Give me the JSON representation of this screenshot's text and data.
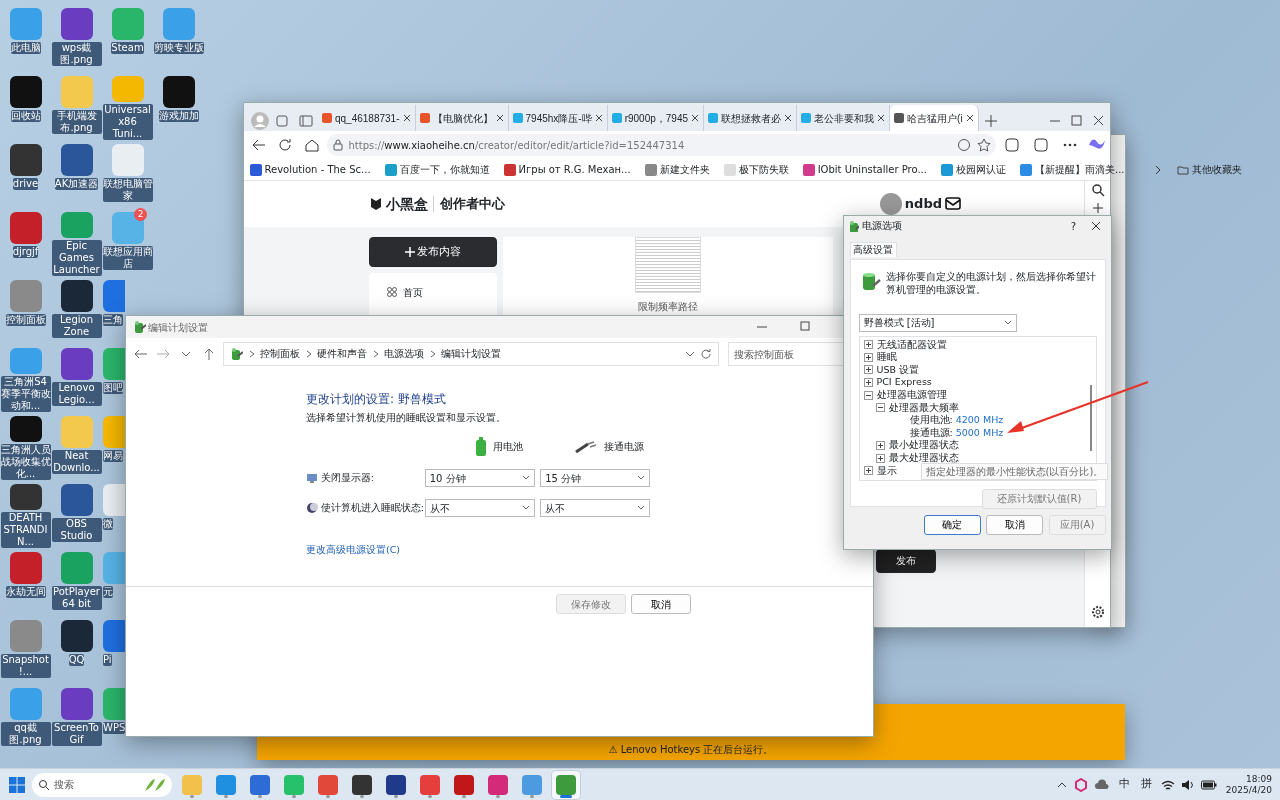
{
  "desktop": {
    "columns": [
      {
        "items": [
          {
            "label": "此电脑"
          },
          {
            "label": "回收站"
          },
          {
            "label": "drive"
          },
          {
            "label": "djrgjf"
          },
          {
            "label": "控制面板"
          },
          {
            "label": "三角洲S4赛季平衡改动和..."
          },
          {
            "label": "三角洲人员战场收集优化..."
          },
          {
            "label": "DEATH STRANDIN..."
          },
          {
            "label": "永劫无间"
          },
          {
            "label": "Snapshot!..."
          },
          {
            "label": "qq截图.png"
          }
        ]
      },
      {
        "items": [
          {
            "label": "wps截图.png"
          },
          {
            "label": "手机端发布.png"
          },
          {
            "label": "AK加速器"
          },
          {
            "label": "Epic Games Launcher"
          },
          {
            "label": "Legion Zone"
          },
          {
            "label": "Lenovo Legio..."
          },
          {
            "label": "Neat Downlo..."
          },
          {
            "label": "OBS Studio"
          },
          {
            "label": "PotPlayer 64 bit"
          },
          {
            "label": "QQ"
          },
          {
            "label": "ScreenToGif"
          }
        ]
      },
      {
        "items": [
          {
            "label": "Steam"
          },
          {
            "label": "Universal x86 Tuni..."
          },
          {
            "label": "联想电脑管家"
          },
          {
            "label": "联想应用商店",
            "badge": "2"
          },
          {
            "label": "三角"
          },
          {
            "label": "图吧"
          },
          {
            "label": "网易"
          },
          {
            "label": "微"
          },
          {
            "label": "元"
          },
          {
            "label": "Pi"
          },
          {
            "label": "WPS"
          }
        ]
      },
      {
        "items": [
          {
            "label": "剪映专业版"
          },
          {
            "label": "游戏加加"
          }
        ]
      }
    ]
  },
  "browser": {
    "tabs": [
      {
        "title": "qq_46188731-",
        "selected": false
      },
      {
        "title": "【电脑优化】",
        "selected": false
      },
      {
        "title": "7945hx降压-哔",
        "selected": false
      },
      {
        "title": "r9000p，7945",
        "selected": false
      },
      {
        "title": "联想拯救者必",
        "selected": false
      },
      {
        "title": "老公非要和我",
        "selected": false
      },
      {
        "title": "哈吉猛用户(i",
        "selected": true
      }
    ],
    "address": {
      "prefix": "https://",
      "host": "www.xiaoheihe.cn",
      "path": "/creator/editor/edit/article?id=152447314"
    },
    "bookmarks": [
      "Revolution - The Sc...",
      "百度一下，你就知道",
      "Игры от R.G. Механ...",
      "新建文件夹",
      "极下防失联",
      "IObit Uninstaller Pro...",
      "校园网认证",
      "【新提醒】雨滴美..."
    ],
    "other_bookmarks": "其他收藏夹",
    "page": {
      "logo": "小黑盒",
      "section": "创作者中心",
      "username": "ndbd",
      "publish_content": "发布内容",
      "nav": [
        {
          "label": "首页"
        }
      ],
      "image_caption": "限制频率路径",
      "publish": "发布"
    }
  },
  "notification": {
    "text": "⚠ Lenovo Hotkeys 正在后台运行。"
  },
  "edit_plan": {
    "title": "编辑计划设置",
    "breadcrumb": [
      "控制面板",
      "硬件和声音",
      "电源选项",
      "编辑计划设置"
    ],
    "search": {
      "placeholder": "搜索控制面板"
    },
    "heading": "更改计划的设置: 野兽模式",
    "description": "选择希望计算机使用的睡眠设置和显示设置。",
    "columns": [
      "用电池",
      "接通电源"
    ],
    "settings": [
      {
        "kind": "display",
        "label": "关闭显示器:",
        "values": [
          "10 分钟",
          "15 分钟"
        ]
      },
      {
        "kind": "sleep",
        "label": "使计算机进入睡眠状态:",
        "values": [
          "从不",
          "从不"
        ]
      }
    ],
    "advanced_link": "更改高级电源设置(C)",
    "buttons": [
      {
        "label": "保存修改",
        "disabled": true
      },
      {
        "label": "取消",
        "disabled": false
      }
    ]
  },
  "power_options": {
    "title": "电源选项",
    "help": "?",
    "tab": "高级设置",
    "intro": "选择你要自定义的电源计划，然后选择你希望计算机管理的电源设置。",
    "plan": "野兽模式 [活动]",
    "tree": [
      {
        "label": "无线适配器设置",
        "expanded": false
      },
      {
        "label": "睡眠",
        "expanded": false
      },
      {
        "label": "USB 设置",
        "expanded": false
      },
      {
        "label": "PCI Express",
        "expanded": false
      },
      {
        "label": "处理器电源管理",
        "expanded": true,
        "children": [
          {
            "label": "处理器最大频率",
            "expanded": true,
            "children": [
              {
                "label": "使用电池:",
                "value": "4200 MHz"
              },
              {
                "label": "接通电源:",
                "value": "5000 MHz"
              }
            ]
          },
          {
            "label": "最小处理器状态",
            "expanded": false
          },
          {
            "label": "最大处理器状态",
            "expanded": false
          }
        ]
      },
      {
        "label": "显示",
        "expanded": false
      }
    ],
    "tooltip": "指定处理器的最小性能状态(以百分比)。",
    "restore": {
      "label": "还原计划默认值(R)",
      "disabled": true
    },
    "buttons": [
      {
        "label": "确定",
        "disabled": false
      },
      {
        "label": "取消",
        "disabled": false
      },
      {
        "label": "应用(A)",
        "disabled": true
      }
    ]
  },
  "taskbar": {
    "search": {
      "placeholder": "搜索"
    },
    "apps": [
      {
        "selected": false
      },
      {
        "selected": false
      },
      {
        "selected": false
      },
      {
        "selected": false
      },
      {
        "selected": false
      },
      {
        "selected": false
      },
      {
        "selected": false
      },
      {
        "selected": false
      },
      {
        "selected": false
      },
      {
        "selected": false
      },
      {
        "selected": false
      },
      {
        "selected": true
      }
    ],
    "tray": {
      "ime_mode": "中",
      "ime": "拼",
      "time": "18:09",
      "date": "2025/4/20"
    }
  }
}
